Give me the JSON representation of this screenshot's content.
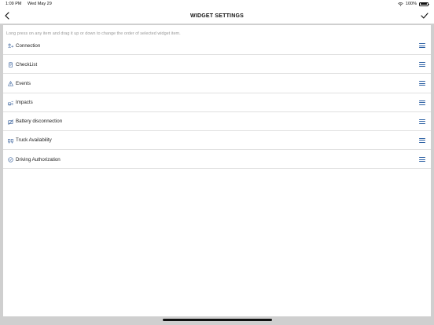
{
  "status_bar": {
    "time": "1:09 PM",
    "date": "Wed May 29",
    "battery": "100%"
  },
  "nav": {
    "title": "WIDGET SETTINGS",
    "back_icon": "chevron-left-icon",
    "done_icon": "checkmark-icon"
  },
  "hint": "Long press on any item and drag it up or down to change the order of selected widget item.",
  "widgets": [
    {
      "label": "Connection",
      "icon": "connection-icon"
    },
    {
      "label": "CheckList",
      "icon": "checklist-icon"
    },
    {
      "label": "Events",
      "icon": "warning-icon"
    },
    {
      "label": "Impacts",
      "icon": "impact-icon"
    },
    {
      "label": "Battery disconnection",
      "icon": "battery-disconnect-icon"
    },
    {
      "label": "Truck Availability",
      "icon": "truck-availability-icon"
    },
    {
      "label": "Driving Authorization",
      "icon": "authorization-icon"
    }
  ],
  "colors": {
    "accent": "#2b5fa3",
    "icon": "#4a6fa5",
    "frame": "#cfcfcf",
    "divider": "#e0e0e0"
  }
}
